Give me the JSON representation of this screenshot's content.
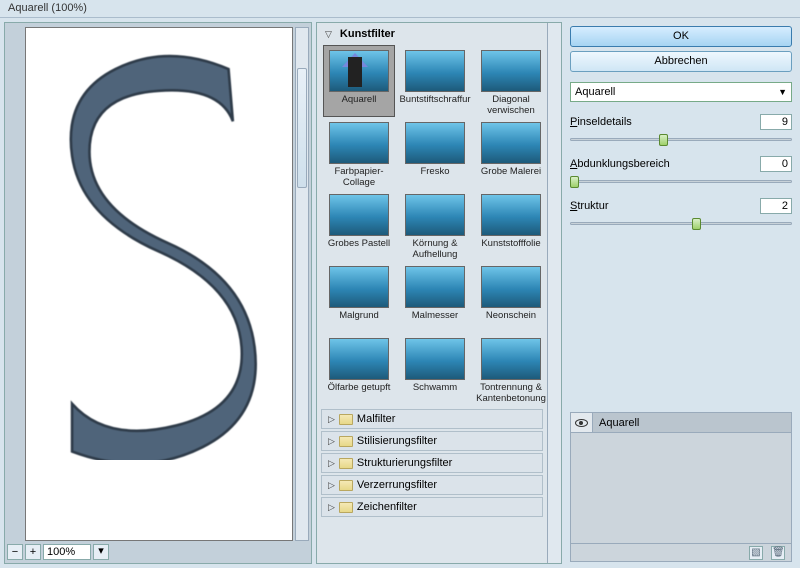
{
  "title": "Aquarell (100%)",
  "preview": {
    "zoom": "100%",
    "minus": "−",
    "plus": "+"
  },
  "gallery": {
    "open_category": "Kunstfilter",
    "thumbs": [
      {
        "label": "Aquarell",
        "selected": true
      },
      {
        "label": "Buntstiftschraffur"
      },
      {
        "label": "Diagonal verwischen"
      },
      {
        "label": "Farbpapier-Collage"
      },
      {
        "label": "Fresko"
      },
      {
        "label": "Grobe Malerei"
      },
      {
        "label": "Grobes Pastell"
      },
      {
        "label": "Körnung & Aufhellung"
      },
      {
        "label": "Kunststofffolie"
      },
      {
        "label": "Malgrund"
      },
      {
        "label": "Malmesser"
      },
      {
        "label": "Neonschein"
      },
      {
        "label": "Ölfarbe getupft"
      },
      {
        "label": "Schwamm"
      },
      {
        "label": "Tontrennung & Kantenbetonung"
      }
    ],
    "collapsed": [
      "Malfilter",
      "Stilisierungsfilter",
      "Strukturierungsfilter",
      "Verzerrungsfilter",
      "Zeichenfilter"
    ]
  },
  "buttons": {
    "ok": "OK",
    "cancel": "Abbrechen"
  },
  "filter_select": "Aquarell",
  "params": [
    {
      "label": "Pinseldetails",
      "value": "9",
      "min": 1,
      "max": 14,
      "pos": 40
    },
    {
      "label": "Abdunklungsbereich",
      "value": "0",
      "min": 0,
      "max": 20,
      "pos": 0
    },
    {
      "label": "Struktur",
      "value": "2",
      "min": 1,
      "max": 3,
      "pos": 55
    }
  ],
  "layer": {
    "name": "Aquarell"
  },
  "colors": {
    "accent": "#3a7cae",
    "panel": "#d7e4ed"
  }
}
